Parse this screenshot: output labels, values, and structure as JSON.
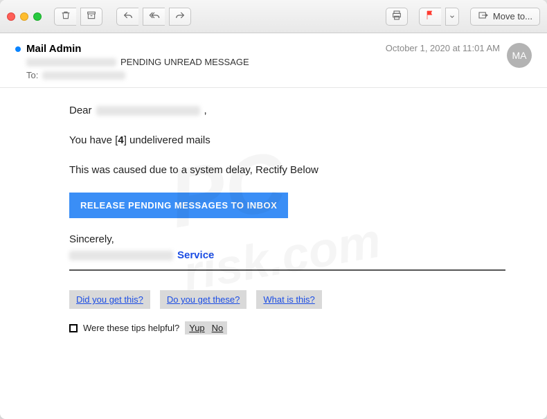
{
  "toolbar": {
    "move_to_label": "Move to..."
  },
  "header": {
    "from_name": "Mail Admin",
    "subject_suffix": "PENDING UNREAD MESSAGE",
    "to_label": "To:",
    "timestamp": "October 1, 2020 at 11:01 AM",
    "avatar_initials": "MA"
  },
  "body": {
    "greeting_prefix": "Dear",
    "greeting_suffix": ",",
    "line_undelivered_pre": "You have [",
    "line_undelivered_count": "4",
    "line_undelivered_post": "] undelivered mails",
    "line_cause": "This was caused due to a system delay, Rectify Below",
    "cta_label": "RELEASE PENDING MESSAGES TO INBOX",
    "sincerely": "Sincerely,",
    "service_word": "Service",
    "tips": [
      "Did you get this?",
      "Do you get these?",
      "What is this?"
    ],
    "helpful_prompt": "Were these tips helpful?",
    "helpful_yes": "Yup",
    "helpful_no": "No"
  },
  "colors": {
    "accent": "#3a8ef6",
    "link": "#1b4de4",
    "flag": "#ff3b30"
  }
}
